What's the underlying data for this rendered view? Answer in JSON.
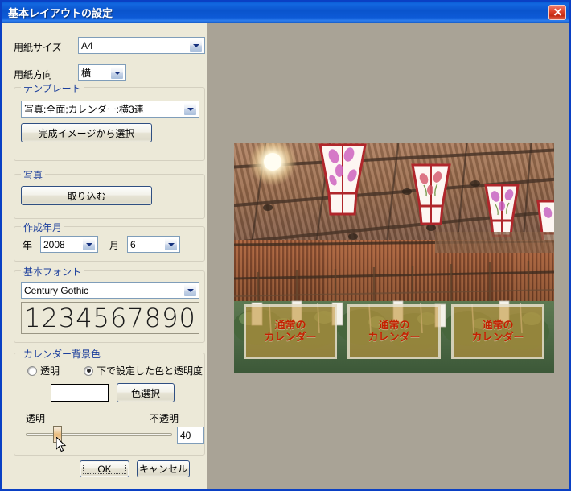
{
  "window": {
    "title": "基本レイアウトの設定",
    "close_label": "×"
  },
  "form": {
    "paper_size": {
      "label": "用紙サイズ",
      "value": "A4"
    },
    "paper_orientation": {
      "label": "用紙方向",
      "value": "横"
    },
    "template": {
      "group_label": "テンプレート",
      "value": "写真:全面;カレンダー:横3連",
      "select_button": "完成イメージから選択"
    },
    "photo": {
      "group_label": "写真",
      "import_button": "取り込む"
    },
    "date": {
      "group_label": "作成年月",
      "year_label": "年",
      "year_value": "2008",
      "month_label": "月",
      "month_value": "6"
    },
    "font": {
      "group_label": "基本フォント",
      "value": "Century Gothic",
      "preview_text": "1234567890"
    },
    "background": {
      "group_label": "カレンダー背景色",
      "radio_transparent": "透明",
      "radio_custom": "下で設定した色と透明度",
      "selected": "custom",
      "swatch_color": "#ffffff",
      "color_button": "色選択",
      "slider_min_label": "透明",
      "slider_max_label": "不透明",
      "opacity_value": "40",
      "slider_percent": 20
    }
  },
  "footer": {
    "ok_label": "OK",
    "cancel_label": "キャンセル"
  },
  "preview": {
    "calendar_boxes": [
      {
        "line1": "通常の",
        "line2": "カレンダー"
      },
      {
        "line1": "通常の",
        "line2": "カレンダー"
      },
      {
        "line1": "通常の",
        "line2": "カレンダー"
      }
    ]
  },
  "colors": {
    "titlebar_blue": "#0a54cd",
    "window_border": "#0a40c4",
    "dialog_face": "#ece9d8",
    "preview_backdrop": "#a9a396",
    "group_label": "#1c3f9c",
    "calendar_text": "#c42000",
    "calendar_fill": "#c4983e"
  }
}
